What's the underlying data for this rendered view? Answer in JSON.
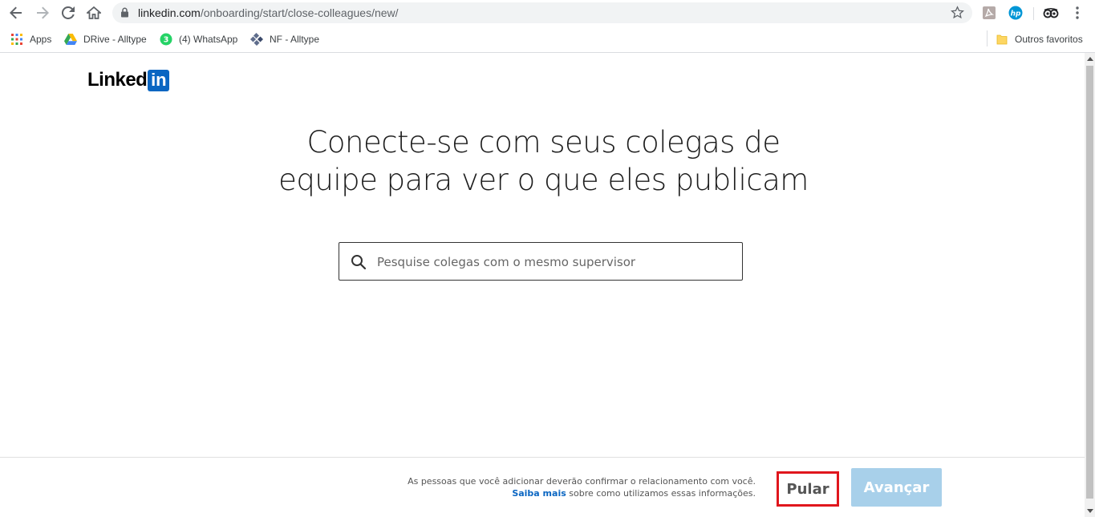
{
  "browser": {
    "url_host": "linkedin.com",
    "url_path": "/onboarding/start/close-colleagues/new/",
    "bookmarks": [
      {
        "label": "Apps",
        "icon": "apps-grid-icon"
      },
      {
        "label": "DRive - Alltype",
        "icon": "google-drive-icon"
      },
      {
        "label": "(4) WhatsApp",
        "icon": "whatsapp-icon",
        "badge": "3"
      },
      {
        "label": "NF - Alltype",
        "icon": "nf-diamond-icon"
      }
    ],
    "other_bookmarks": "Outros favoritos"
  },
  "page": {
    "logo_word": "Linked",
    "logo_box": "in",
    "headline_line1": "Conecte-se com seus colegas de",
    "headline_line2": "equipe para ver o que eles publicam",
    "search_placeholder": "Pesquise colegas com o mesmo supervisor"
  },
  "footer": {
    "note_line1": "As pessoas que você adicionar deverão confirmar o relacionamento com você.",
    "learn_more": "Saiba mais",
    "note_line2_rest": " sobre como utilizamos essas informações.",
    "skip_label": "Pular",
    "next_label": "Avançar"
  },
  "colors": {
    "brand": "#0a66c2",
    "next_disabled": "#a8d0ea",
    "highlight_box": "#e0161d"
  }
}
